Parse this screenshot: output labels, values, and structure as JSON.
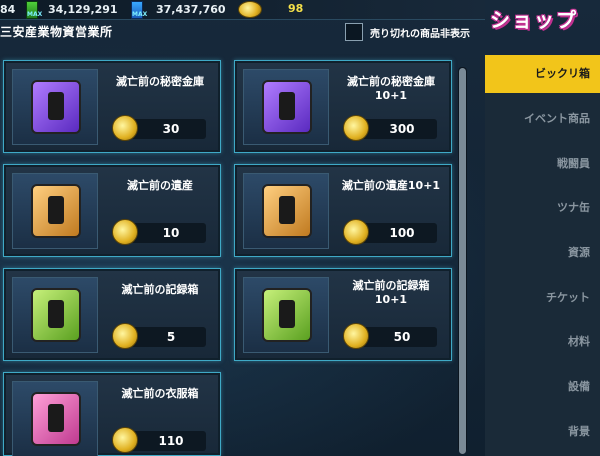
{
  "topbar": {
    "res1_value": "84",
    "res1_tag": "MAX",
    "res2_value": "34,129,291",
    "res2_tag": "MAX",
    "res3_value": "37,437,760",
    "coin_value": "98"
  },
  "header": {
    "section_title": "三安産業物資営業所",
    "sold_out_label": "売り切れの商品非表示"
  },
  "shop_title": "ショップ",
  "sidebar": {
    "items": [
      {
        "label": "ビックリ箱"
      },
      {
        "label": "イベント商品"
      },
      {
        "label": "戦闘員"
      },
      {
        "label": "ツナ缶"
      },
      {
        "label": "資源"
      },
      {
        "label": "チケット"
      },
      {
        "label": "材料"
      },
      {
        "label": "設備"
      },
      {
        "label": "背景"
      }
    ]
  },
  "products": [
    {
      "name": "滅亡前の秘密金庫",
      "price": "30",
      "color": "#7a4cff"
    },
    {
      "name": "滅亡前の秘密金庫10+1",
      "price": "300",
      "color": "#7a4cff"
    },
    {
      "name": "滅亡前の遺産",
      "price": "10",
      "color": "#e0a040"
    },
    {
      "name": "滅亡前の遺産10+1",
      "price": "100",
      "color": "#e0a040"
    },
    {
      "name": "滅亡前の記録箱",
      "price": "5",
      "color": "#8ad040"
    },
    {
      "name": "滅亡前の記録箱\n10+1",
      "price": "50",
      "color": "#8ad040"
    },
    {
      "name": "滅亡前の衣服箱",
      "price": "110",
      "color": "#e06ab0"
    }
  ],
  "colors": {
    "accent": "#f2c51a",
    "card_border": "#3fa9c6",
    "background": "#142536"
  }
}
